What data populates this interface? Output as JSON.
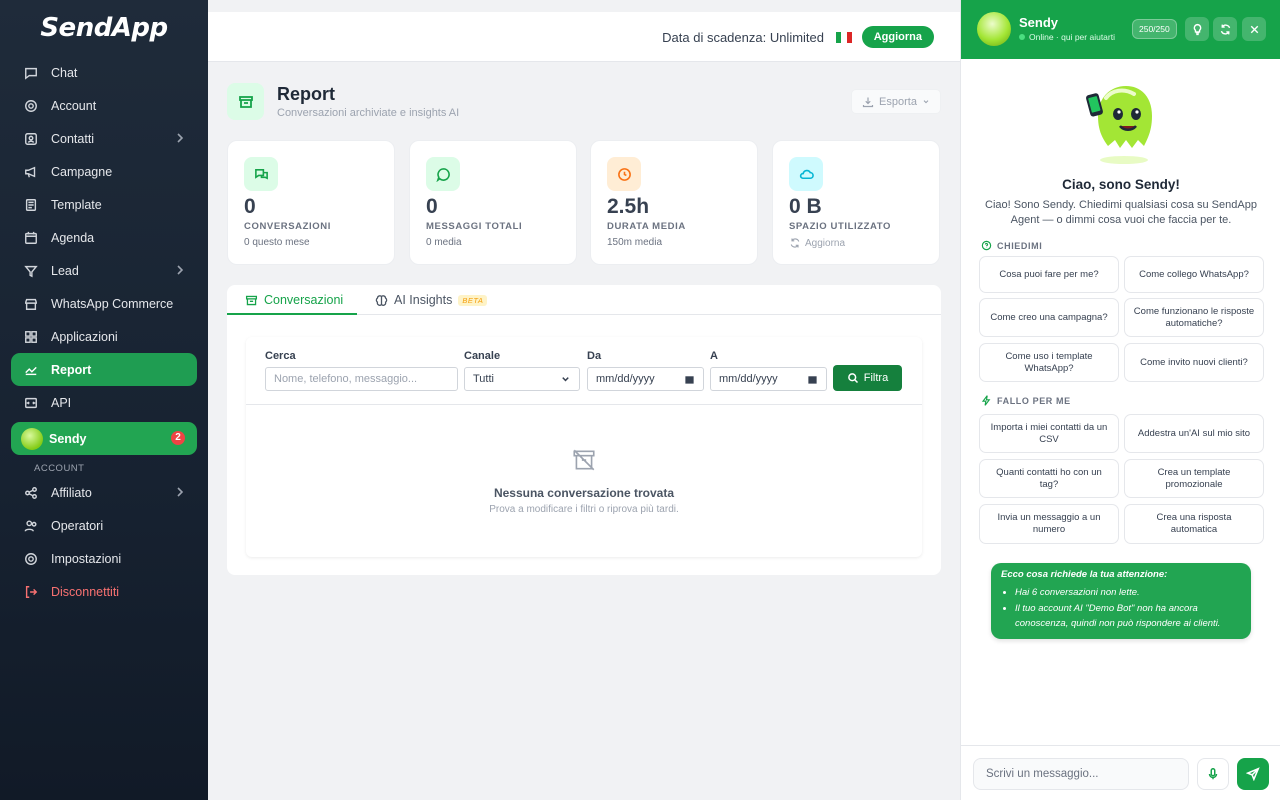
{
  "app": {
    "logo": "SendApp"
  },
  "sidebar": {
    "items": [
      {
        "label": "Chat",
        "icon": "chat-icon"
      },
      {
        "label": "Account",
        "icon": "gear-icon"
      },
      {
        "label": "Contatti",
        "icon": "contacts-icon",
        "chevron": true
      },
      {
        "label": "Campagne",
        "icon": "megaphone-icon"
      },
      {
        "label": "Template",
        "icon": "template-icon"
      },
      {
        "label": "Agenda",
        "icon": "calendar-icon"
      },
      {
        "label": "Lead",
        "icon": "filter-icon",
        "chevron": true
      },
      {
        "label": "WhatsApp Commerce",
        "icon": "shop-icon"
      },
      {
        "label": "Applicazioni",
        "icon": "apps-icon"
      },
      {
        "label": "Report",
        "icon": "chart-icon",
        "active": true
      },
      {
        "label": "API",
        "icon": "code-icon"
      },
      {
        "label": "Sendy",
        "icon": "sendy-avatar",
        "badge": "2"
      }
    ],
    "section_label": "ACCOUNT",
    "account_items": [
      {
        "label": "Affiliato",
        "icon": "share-icon",
        "chevron": true
      },
      {
        "label": "Operatori",
        "icon": "users-icon"
      },
      {
        "label": "Impostazioni",
        "icon": "settings-icon"
      },
      {
        "label": "Disconnettiti",
        "icon": "logout-icon"
      }
    ]
  },
  "topbar": {
    "expiry": "Data di scadenza: Unlimited",
    "upgrade_label": "Aggiorna"
  },
  "page": {
    "title": "Report",
    "subtitle": "Conversazioni archiviate e insights AI",
    "export_label": "Esporta"
  },
  "stats": [
    {
      "value": "0",
      "label": "CONVERSAZIONI",
      "sub": "0 questo mese",
      "icon": "chat-bubbles-icon",
      "color": "#16a34a",
      "bg": "#dcfce7"
    },
    {
      "value": "0",
      "label": "MESSAGGI TOTALI",
      "sub": "0 media",
      "icon": "message-icon",
      "color": "#16a34a",
      "bg": "#dcfce7"
    },
    {
      "value": "2.5h",
      "label": "DURATA MEDIA",
      "sub": "150m media",
      "icon": "clock-icon",
      "color": "#f97316",
      "bg": "#ffedd5"
    },
    {
      "value": "0 B",
      "label": "SPAZIO UTILIZZATO",
      "sub": "Aggiorna",
      "icon": "cloud-icon",
      "color": "#06b6d4",
      "bg": "#cffafe"
    }
  ],
  "tabs": [
    {
      "label": "Conversazioni",
      "active": true
    },
    {
      "label": "AI Insights",
      "badge": "BETA"
    }
  ],
  "filters": {
    "search_label": "Cerca",
    "search_placeholder": "Nome, telefono, messaggio...",
    "channel_label": "Canale",
    "channel_value": "Tutti",
    "from_label": "Da",
    "from_placeholder": "mm/dd/yyyy",
    "to_label": "A",
    "to_placeholder": "mm/dd/yyyy",
    "button_label": "Filtra"
  },
  "empty": {
    "title": "Nessuna conversazione trovata",
    "subtitle": "Prova a modificare i filtri o riprova più tardi."
  },
  "assistant": {
    "name": "Sendy",
    "status": "Online · qui per aiutarti",
    "count": "250/250",
    "hello": "Ciao, sono Sendy!",
    "intro": "Ciao! Sono Sendy. Chiedimi qualsiasi cosa su SendApp Agent — o dimmi cosa vuoi che faccia per te.",
    "ask_section": "CHIEDIMI",
    "ask_chips": [
      "Cosa puoi fare per me?",
      "Come collego WhatsApp?",
      "Come creo una campagna?",
      "Come funzionano le risposte automatiche?",
      "Come uso i template WhatsApp?",
      "Come invito nuovi clienti?"
    ],
    "do_section": "FALLO PER ME",
    "do_chips": [
      "Importa i miei contatti da un CSV",
      "Addestra un'AI sul mio sito",
      "Quanti contatti ho con un tag?",
      "Crea un template promozionale",
      "Invia un messaggio a un numero",
      "Crea una risposta automatica"
    ],
    "alert_title": "Ecco cosa richiede la tua attenzione:",
    "alert_items": [
      "Hai 6 conversazioni non lette.",
      "Il tuo account AI \"Demo Bot\" non ha ancora conoscenza, quindi non può rispondere ai clienti."
    ],
    "input_placeholder": "Scrivi un messaggio..."
  }
}
